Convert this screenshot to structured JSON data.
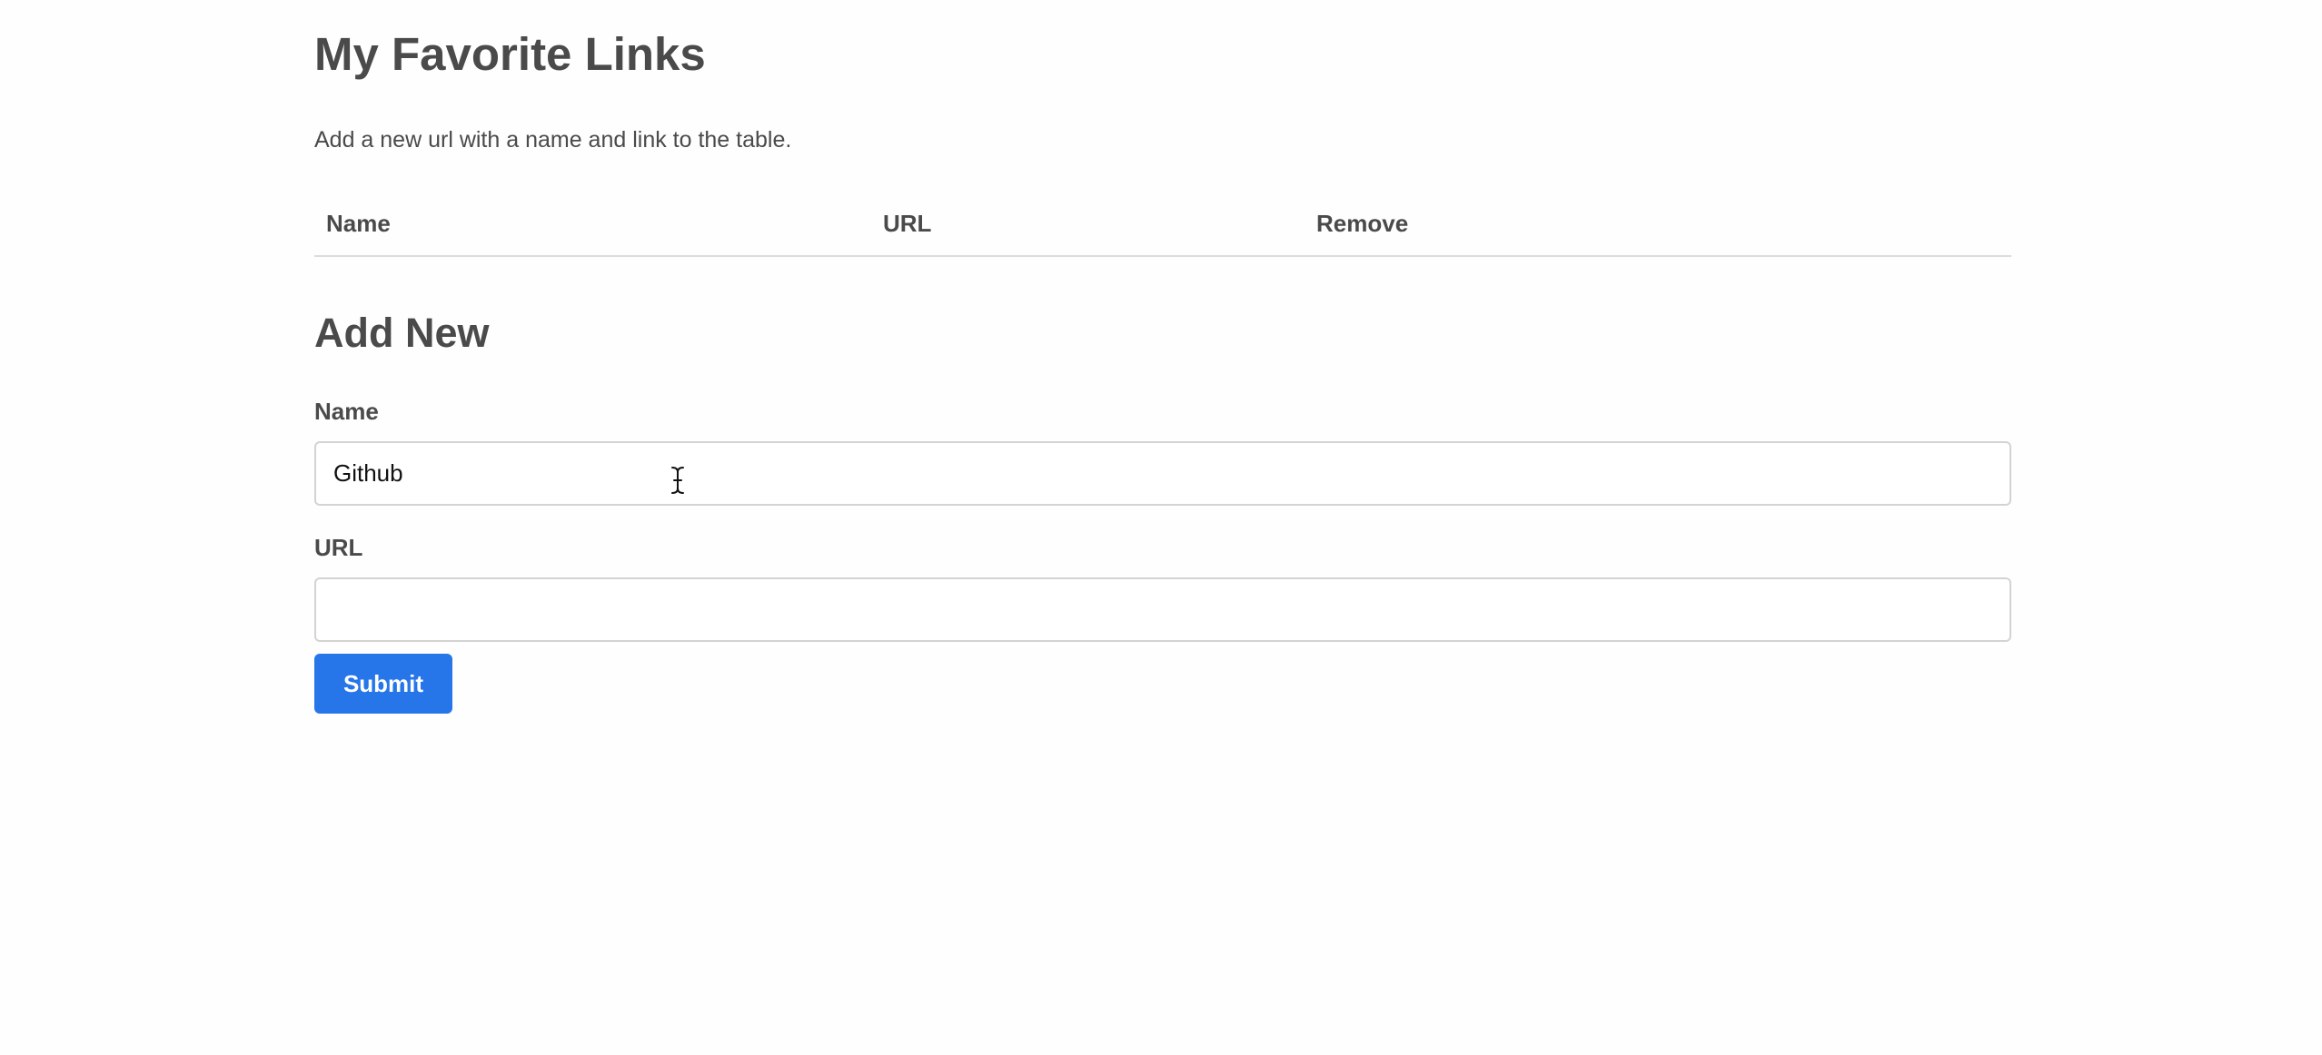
{
  "header": {
    "title": "My Favorite Links",
    "description": "Add a new url with a name and link to the table."
  },
  "table": {
    "columns": [
      "Name",
      "URL",
      "Remove"
    ],
    "rows": []
  },
  "form": {
    "title": "Add New",
    "name_label": "Name",
    "name_value": "Github",
    "url_label": "URL",
    "url_value": "",
    "submit_label": "Submit"
  },
  "colors": {
    "accent": "#2676ea",
    "text": "#4a4a4a",
    "border": "#d3d3d3",
    "background": "#fefefe"
  },
  "icons": {
    "cursor": "text-cursor-icon"
  }
}
